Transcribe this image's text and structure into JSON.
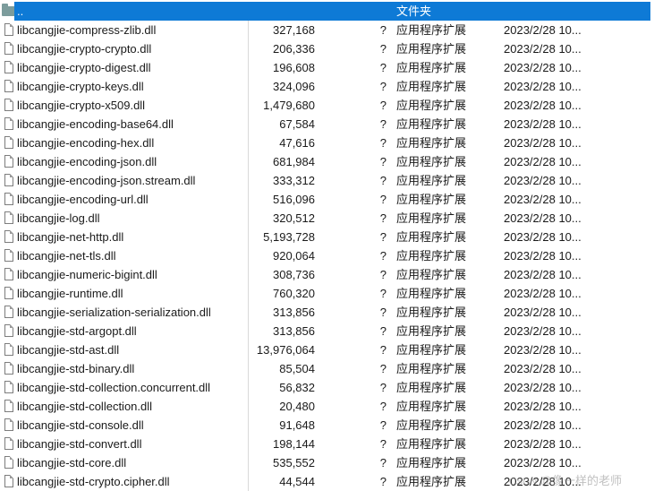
{
  "parent_row": {
    "name": "..",
    "type": "文件夹"
  },
  "rows": [
    {
      "name": "libcangjie-compress-zlib.dll",
      "size": "327,168",
      "ratio": "?",
      "type": "应用程序扩展",
      "modified": "2023/2/28 10..."
    },
    {
      "name": "libcangjie-crypto-crypto.dll",
      "size": "206,336",
      "ratio": "?",
      "type": "应用程序扩展",
      "modified": "2023/2/28 10..."
    },
    {
      "name": "libcangjie-crypto-digest.dll",
      "size": "196,608",
      "ratio": "?",
      "type": "应用程序扩展",
      "modified": "2023/2/28 10..."
    },
    {
      "name": "libcangjie-crypto-keys.dll",
      "size": "324,096",
      "ratio": "?",
      "type": "应用程序扩展",
      "modified": "2023/2/28 10..."
    },
    {
      "name": "libcangjie-crypto-x509.dll",
      "size": "1,479,680",
      "ratio": "?",
      "type": "应用程序扩展",
      "modified": "2023/2/28 10..."
    },
    {
      "name": "libcangjie-encoding-base64.dll",
      "size": "67,584",
      "ratio": "?",
      "type": "应用程序扩展",
      "modified": "2023/2/28 10..."
    },
    {
      "name": "libcangjie-encoding-hex.dll",
      "size": "47,616",
      "ratio": "?",
      "type": "应用程序扩展",
      "modified": "2023/2/28 10..."
    },
    {
      "name": "libcangjie-encoding-json.dll",
      "size": "681,984",
      "ratio": "?",
      "type": "应用程序扩展",
      "modified": "2023/2/28 10..."
    },
    {
      "name": "libcangjie-encoding-json.stream.dll",
      "size": "333,312",
      "ratio": "?",
      "type": "应用程序扩展",
      "modified": "2023/2/28 10..."
    },
    {
      "name": "libcangjie-encoding-url.dll",
      "size": "516,096",
      "ratio": "?",
      "type": "应用程序扩展",
      "modified": "2023/2/28 10..."
    },
    {
      "name": "libcangjie-log.dll",
      "size": "320,512",
      "ratio": "?",
      "type": "应用程序扩展",
      "modified": "2023/2/28 10..."
    },
    {
      "name": "libcangjie-net-http.dll",
      "size": "5,193,728",
      "ratio": "?",
      "type": "应用程序扩展",
      "modified": "2023/2/28 10..."
    },
    {
      "name": "libcangjie-net-tls.dll",
      "size": "920,064",
      "ratio": "?",
      "type": "应用程序扩展",
      "modified": "2023/2/28 10..."
    },
    {
      "name": "libcangjie-numeric-bigint.dll",
      "size": "308,736",
      "ratio": "?",
      "type": "应用程序扩展",
      "modified": "2023/2/28 10..."
    },
    {
      "name": "libcangjie-runtime.dll",
      "size": "760,320",
      "ratio": "?",
      "type": "应用程序扩展",
      "modified": "2023/2/28 10..."
    },
    {
      "name": "libcangjie-serialization-serialization.dll",
      "size": "313,856",
      "ratio": "?",
      "type": "应用程序扩展",
      "modified": "2023/2/28 10..."
    },
    {
      "name": "libcangjie-std-argopt.dll",
      "size": "313,856",
      "ratio": "?",
      "type": "应用程序扩展",
      "modified": "2023/2/28 10..."
    },
    {
      "name": "libcangjie-std-ast.dll",
      "size": "13,976,064",
      "ratio": "?",
      "type": "应用程序扩展",
      "modified": "2023/2/28 10..."
    },
    {
      "name": "libcangjie-std-binary.dll",
      "size": "85,504",
      "ratio": "?",
      "type": "应用程序扩展",
      "modified": "2023/2/28 10..."
    },
    {
      "name": "libcangjie-std-collection.concurrent.dll",
      "size": "56,832",
      "ratio": "?",
      "type": "应用程序扩展",
      "modified": "2023/2/28 10..."
    },
    {
      "name": "libcangjie-std-collection.dll",
      "size": "20,480",
      "ratio": "?",
      "type": "应用程序扩展",
      "modified": "2023/2/28 10..."
    },
    {
      "name": "libcangjie-std-console.dll",
      "size": "91,648",
      "ratio": "?",
      "type": "应用程序扩展",
      "modified": "2023/2/28 10..."
    },
    {
      "name": "libcangjie-std-convert.dll",
      "size": "198,144",
      "ratio": "?",
      "type": "应用程序扩展",
      "modified": "2023/2/28 10..."
    },
    {
      "name": "libcangjie-std-core.dll",
      "size": "535,552",
      "ratio": "?",
      "type": "应用程序扩展",
      "modified": "2023/2/28 10..."
    },
    {
      "name": "libcangjie-std-crypto.cipher.dll",
      "size": "44,544",
      "ratio": "?",
      "type": "应用程序扩展",
      "modified": "2023/2/28 10..."
    }
  ],
  "watermark": {
    "prefix": "CSDN",
    "text": "@像一样的老师"
  }
}
